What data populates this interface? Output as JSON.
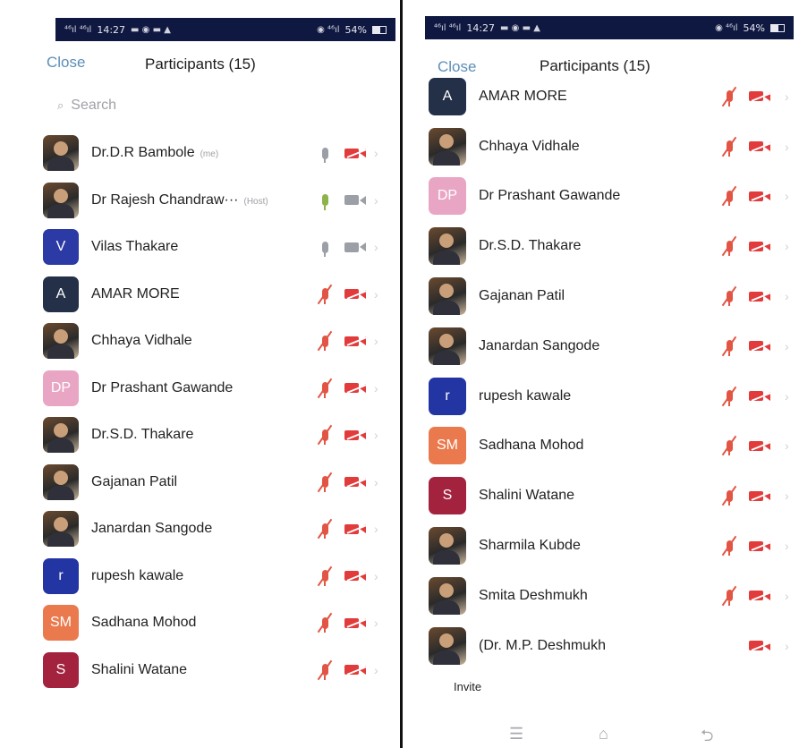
{
  "status_bar": {
    "left": {
      "signal": "⁴⁶ıl ⁴⁶ıl",
      "time": "14:27",
      "icons": "▬ ◉ ▬ ▲"
    },
    "right": {
      "icons": "◉ ⁴⁶ıl",
      "battery": "54%"
    }
  },
  "colors": {
    "link": "#5d8fb8",
    "muted_red": "#e25544",
    "video_off_red": "#e23b3b",
    "green_mic": "#8cb44a",
    "status_bar_bg": "#0f1840"
  },
  "left_panel": {
    "close_label": "Close",
    "title": "Participants (15)",
    "search_placeholder": "Search",
    "participants": [
      {
        "name": "Dr.D.R Bambole",
        "role": "(me)",
        "avatar_type": "photo",
        "mic": "idle",
        "video": "off"
      },
      {
        "name": "Dr Rajesh Chandraw···",
        "role": "(Host)",
        "avatar_type": "photo",
        "mic": "active",
        "video": "on"
      },
      {
        "name": "Vilas Thakare",
        "role": "",
        "avatar_letter": "V",
        "avatar_color": "#2c3aa6",
        "mic": "idle",
        "video": "on"
      },
      {
        "name": "AMAR MORE",
        "role": "",
        "avatar_letter": "A",
        "avatar_color": "#243047",
        "mic": "muted",
        "video": "off"
      },
      {
        "name": "Chhaya Vidhale",
        "role": "",
        "avatar_type": "photo",
        "mic": "muted",
        "video": "off"
      },
      {
        "name": "Dr Prashant Gawande",
        "role": "",
        "avatar_letter": "DP",
        "avatar_color": "#e9a6c4",
        "mic": "muted",
        "video": "off"
      },
      {
        "name": "Dr.S.D. Thakare",
        "role": "",
        "avatar_type": "photo",
        "mic": "muted",
        "video": "off"
      },
      {
        "name": "Gajanan Patil",
        "role": "",
        "avatar_type": "photo",
        "mic": "muted",
        "video": "off"
      },
      {
        "name": "Janardan Sangode",
        "role": "",
        "avatar_type": "photo",
        "mic": "muted",
        "video": "off"
      },
      {
        "name": "rupesh kawale",
        "role": "",
        "avatar_letter": "r",
        "avatar_color": "#2335a3",
        "mic": "muted",
        "video": "off"
      },
      {
        "name": "Sadhana Mohod",
        "role": "",
        "avatar_letter": "SM",
        "avatar_color": "#ea7a4e",
        "mic": "muted",
        "video": "off"
      },
      {
        "name": "Shalini Watane",
        "role": "",
        "avatar_letter": "S",
        "avatar_color": "#a3233f",
        "mic": "muted",
        "video": "off"
      }
    ]
  },
  "right_panel": {
    "close_label": "Close",
    "title": "Participants (15)",
    "participants": [
      {
        "name": "AMAR MORE",
        "avatar_letter": "A",
        "avatar_color": "#243047",
        "mic": "muted",
        "video": "off"
      },
      {
        "name": "Chhaya Vidhale",
        "avatar_type": "photo",
        "mic": "muted",
        "video": "off"
      },
      {
        "name": "Dr Prashant Gawande",
        "avatar_letter": "DP",
        "avatar_color": "#e9a6c4",
        "mic": "muted",
        "video": "off"
      },
      {
        "name": "Dr.S.D. Thakare",
        "avatar_type": "photo",
        "mic": "muted",
        "video": "off"
      },
      {
        "name": "Gajanan Patil",
        "avatar_type": "photo",
        "mic": "muted",
        "video": "off"
      },
      {
        "name": "Janardan Sangode",
        "avatar_type": "photo",
        "mic": "muted",
        "video": "off"
      },
      {
        "name": "rupesh kawale",
        "avatar_letter": "r",
        "avatar_color": "#2335a3",
        "mic": "muted",
        "video": "off"
      },
      {
        "name": "Sadhana Mohod",
        "avatar_letter": "SM",
        "avatar_color": "#ea7a4e",
        "mic": "muted",
        "video": "off"
      },
      {
        "name": "Shalini Watane",
        "avatar_letter": "S",
        "avatar_color": "#a3233f",
        "mic": "muted",
        "video": "off"
      },
      {
        "name": "Sharmila Kubde",
        "avatar_type": "photo",
        "mic": "muted",
        "video": "off"
      },
      {
        "name": "Smita Deshmukh",
        "avatar_type": "photo",
        "mic": "muted",
        "video": "off"
      },
      {
        "name": "(Dr. M.P. Deshmukh",
        "avatar_type": "photo",
        "mic": "none",
        "video": "off"
      }
    ],
    "invite_label": "Invite",
    "nav_icons": [
      "menu-icon",
      "home-icon",
      "back-icon"
    ]
  }
}
